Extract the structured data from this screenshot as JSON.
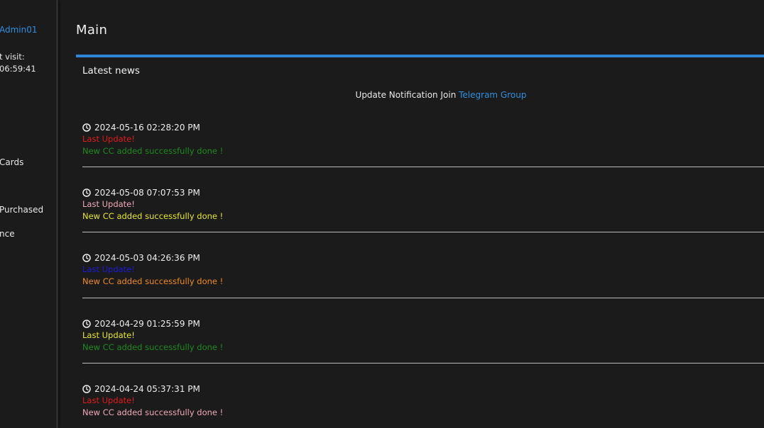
{
  "sidebar": {
    "username": "Admin01",
    "last_visit_label": "t visit:",
    "last_visit_time": "06:59:41",
    "nav": [
      {
        "label": "Cards"
      },
      {
        "label": "Purchased"
      },
      {
        "label": "nce"
      }
    ]
  },
  "main": {
    "title": "Main",
    "panel_title": "Latest news",
    "notice_text": "Update Notification Join",
    "notice_link": "Telegram Group"
  },
  "news": [
    {
      "date": "2024-05-16 02:28:20 PM",
      "heading": "Last Update!",
      "heading_color": "#e01b1b",
      "body": "New CC added successfully done !",
      "body_color": "#1e8a1e"
    },
    {
      "date": "2024-05-08 07:07:53 PM",
      "heading": "Last Update!",
      "heading_color": "#f0a8b8",
      "body": "New CC added successfully done !",
      "body_color": "#e6e62a"
    },
    {
      "date": "2024-05-03 04:26:36 PM",
      "heading": "Last Update!",
      "heading_color": "#1a1ad6",
      "body": "New CC added successfully done !",
      "body_color": "#f08a1e"
    },
    {
      "date": "2024-04-29 01:25:59 PM",
      "heading": "Last Update!",
      "heading_color": "#e6e62a",
      "body": "New CC added successfully done !",
      "body_color": "#1e8a1e"
    },
    {
      "date": "2024-04-24 05:37:31 PM",
      "heading": "Last Update!",
      "heading_color": "#e01b1b",
      "body": "New CC added successfully done !",
      "body_color": "#f0a8b8"
    }
  ],
  "icons": {
    "clock": "clock-icon"
  },
  "colors": {
    "accent": "#2f86d8",
    "link": "#2e8fe0",
    "background": "#1b1b1b"
  }
}
